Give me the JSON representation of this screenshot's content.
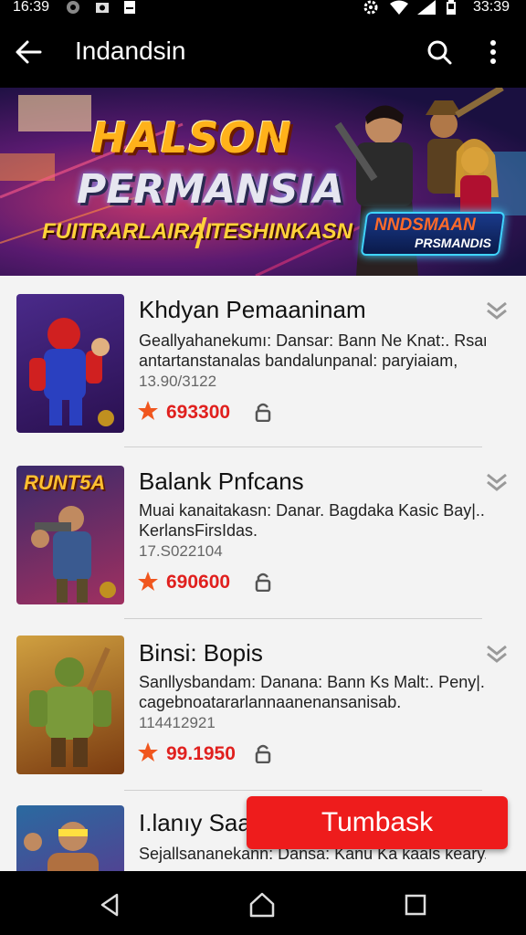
{
  "status_bar": {
    "time_left": "16:39",
    "time_right": "33:39"
  },
  "app_bar": {
    "title": "Indandsin"
  },
  "banner": {
    "headline_1": "HALSON",
    "headline_2": "PERMANSIA",
    "sub_1": "FUITRARLAIRAI",
    "sub_2": "TESHINKASN",
    "badge_line_1": "NNDSMAAN",
    "badge_line_2": "PRSMANDIS"
  },
  "items": [
    {
      "name": "Khdyan Pemaaninam",
      "desc_1": "Geallyahanekumı: Dansar: Bann Ne Knat:. Rsary:.:",
      "desc_2": "antartanstanalas bandalunpanal: paryiaiam,",
      "meta": "13.90/3122",
      "score": "693300",
      "thumb_text": ""
    },
    {
      "name": "Balank Pnfcans",
      "desc_1": "Muai kanaitakasn: Danar. Bagdaka Kasic Bay|...",
      "desc_2": "KerlansFirsIdas.",
      "meta": "17.S022104",
      "score": "690600",
      "thumb_text": "RUNT5A"
    },
    {
      "name": "Binsi: Bopis",
      "desc_1": "Sanllysbandam: Danana: Bann Ks Malt:. Peny|...",
      "desc_2": "cagebnoatararlannaanenansanisab.",
      "meta": "114412921",
      "score": "99.1950",
      "thumb_text": ""
    },
    {
      "name": "I.lanıy Saa",
      "desc_1": "Sejallsananekann: Dansa: Kanu Ka kaals keary...",
      "desc_2": "",
      "meta": "",
      "score": "",
      "thumb_text": ""
    }
  ],
  "fab": {
    "label": "Tumbask"
  },
  "colors": {
    "accent": "#ee1c1c",
    "score": "#e0201e",
    "star": "#f0561e",
    "background": "#f3f3f3"
  }
}
